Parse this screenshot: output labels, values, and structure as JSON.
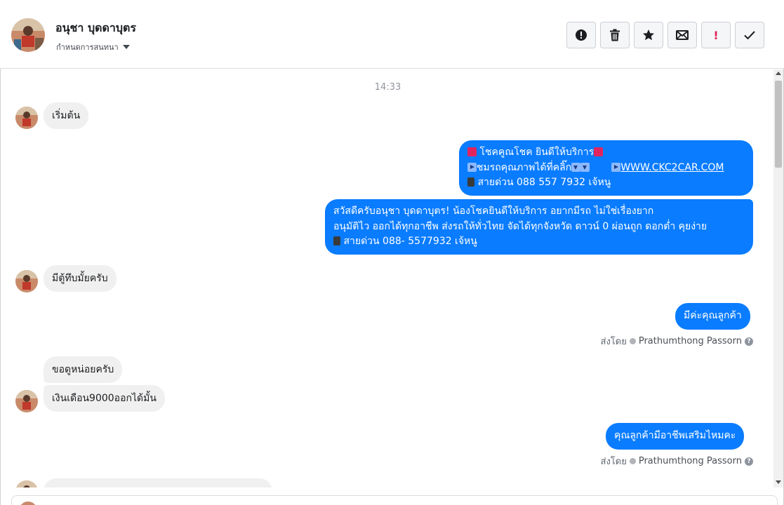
{
  "header": {
    "contact_name": "อนุชา บุดดาบุตร",
    "assign_label": "กำหนดการสนทนา"
  },
  "toolbar": {
    "icons": [
      "exclamation-circle-icon",
      "trash-icon",
      "star-icon",
      "envelope-icon",
      "priority-icon",
      "checkmark-icon"
    ],
    "priority_label": "!"
  },
  "conversation": {
    "timestamp": "14:33",
    "messages": [
      {
        "direction": "in",
        "text": "เริ่มต้น"
      },
      {
        "direction": "out",
        "lines": [
          "โชคคูณโชค ยินดีให้บริการ",
          "ชมรถคุณภาพได้ที่คลิ๊ก",
          "WWW.CKC2CAR.COM",
          "สายด่วน 088 557 7932 เจ้หนู"
        ]
      },
      {
        "direction": "out",
        "lines": [
          "สวัสดีครับอนุชา บุดดาบุตร! น้องโชคยินดีให้บริการ อยากมีรถ ไม่ใช่เรื่องยาก",
          "อนุมัติไว ออกได้ทุกอาชีพ ส่งรถให้ทั่วไทย จัดได้ทุกจังหวัด ดาวน์ 0  ผ่อนถูก ดอกต่ำ คุยง่าย",
          "สายด่วน 088- 5577932 เจ้หนู"
        ]
      },
      {
        "direction": "in",
        "text": "มีตู้ทึบมั้ยครับ"
      },
      {
        "direction": "out",
        "text": "มีค่ะคุณลูกค้า",
        "sent_by_label": "ส่งโดย",
        "sender": "Prathumthong Passorn"
      },
      {
        "direction": "in",
        "text": "ขอดูหน่อยครับ"
      },
      {
        "direction": "in",
        "text": "เงินเดือน9000ออกได้มั้น"
      },
      {
        "direction": "out",
        "text": "คุณลูกค้ามีอาชีพเสริมไหมคะ",
        "sent_by_label": "ส่งโดย",
        "sender": "Prathumthong Passorn"
      }
    ]
  },
  "colors": {
    "outgoing_bubble": "#0a7cff",
    "incoming_bubble": "#f0f0f0"
  }
}
